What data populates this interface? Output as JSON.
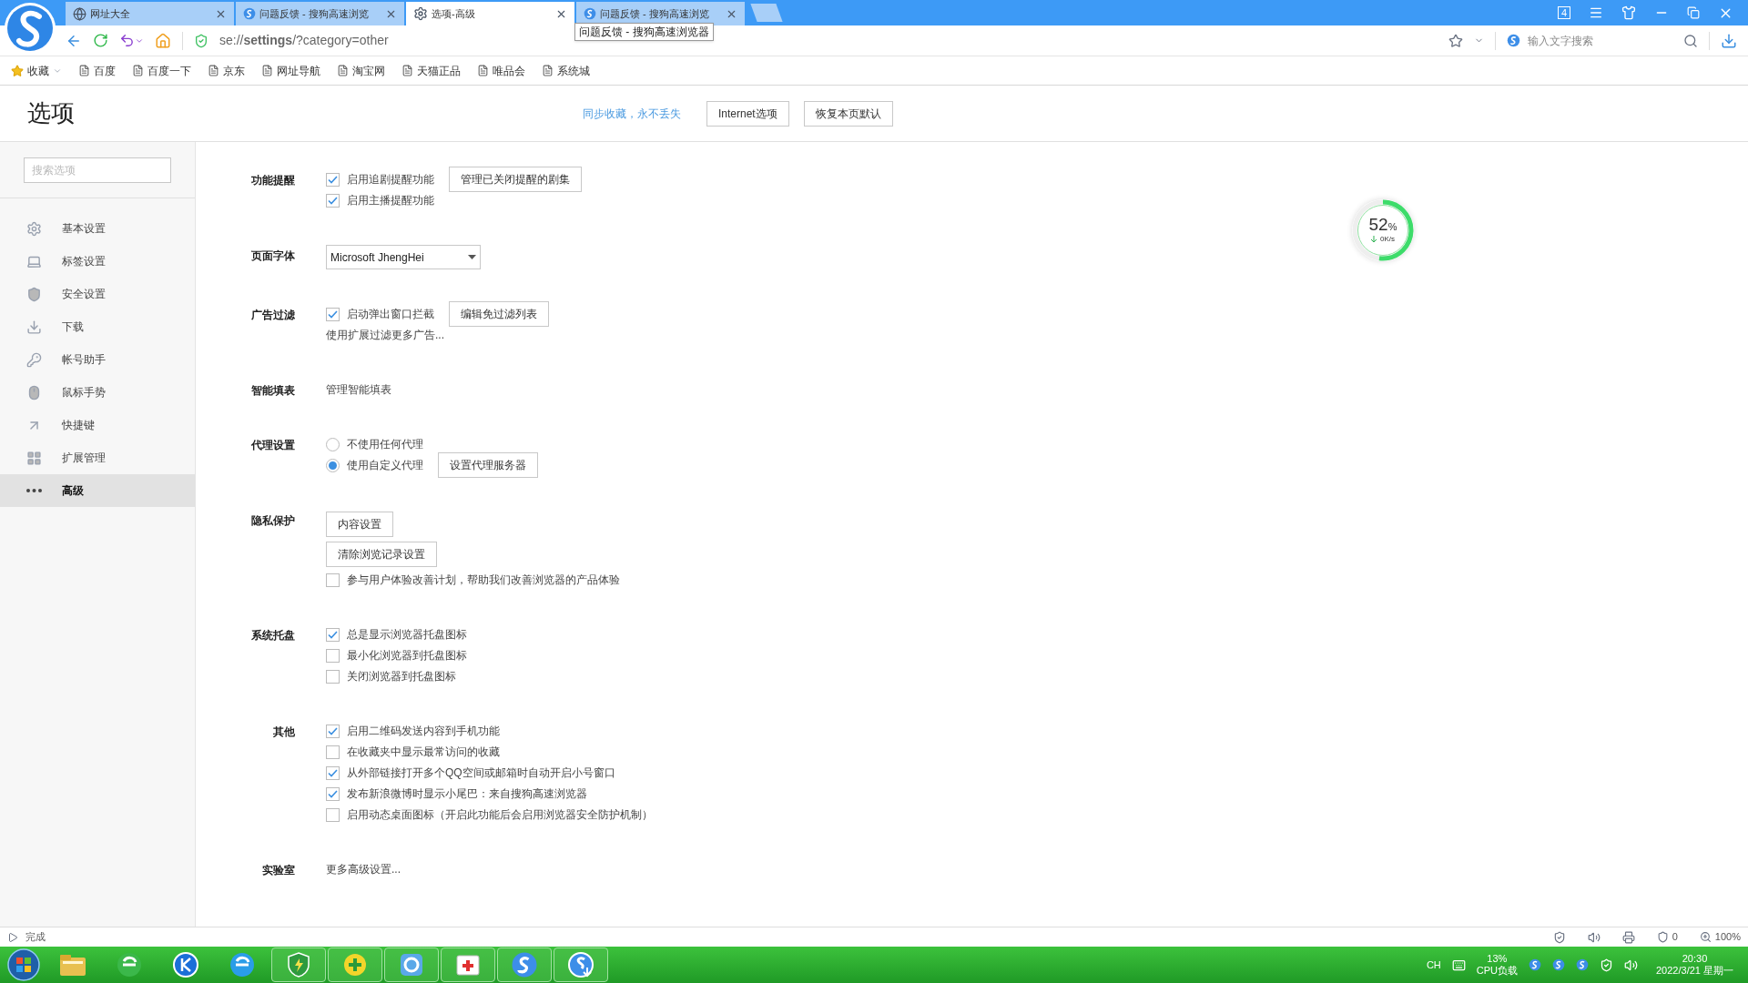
{
  "tabs": [
    {
      "title": "网址大全",
      "selected": false
    },
    {
      "title": "问题反馈 - 搜狗高速浏览",
      "selected": false
    },
    {
      "title": "选项-高级",
      "selected": true
    },
    {
      "title": "问题反馈 - 搜狗高速浏览",
      "selected": false
    }
  ],
  "tooltip": "问题反馈 - 搜狗高速浏览器",
  "tab_count": "4",
  "address": "se://**settings**/?category=other",
  "search": {
    "placeholder": "输入文字搜索"
  },
  "bookmarks": [
    {
      "label": "收藏",
      "kind": "menu"
    },
    {
      "label": "百度",
      "kind": "page"
    },
    {
      "label": "百度一下",
      "kind": "page"
    },
    {
      "label": "京东",
      "kind": "page"
    },
    {
      "label": "网址导航",
      "kind": "page"
    },
    {
      "label": "淘宝网",
      "kind": "page"
    },
    {
      "label": "天猫正品",
      "kind": "page"
    },
    {
      "label": "唯品会",
      "kind": "page"
    },
    {
      "label": "系统城",
      "kind": "page"
    }
  ],
  "header": {
    "title": "选项",
    "sync_link": "同步收藏，永不丢失",
    "buttons": [
      "Internet选项",
      "恢复本页默认"
    ]
  },
  "sidebar": {
    "search": {
      "placeholder": "搜索选项"
    },
    "items": [
      {
        "label": "基本设置",
        "selected": false
      },
      {
        "label": "标签设置",
        "selected": false
      },
      {
        "label": "安全设置",
        "selected": false
      },
      {
        "label": "下载",
        "selected": false
      },
      {
        "label": "帐号助手",
        "selected": false
      },
      {
        "label": "鼠标手势",
        "selected": false
      },
      {
        "label": "快捷键",
        "selected": false
      },
      {
        "label": "扩展管理",
        "selected": false
      },
      {
        "label": "高级",
        "selected": true
      }
    ]
  },
  "sections": [
    {
      "label": "功能提醒",
      "rows": [
        {
          "kind": "checkbox",
          "label": "启用追剧提醒功能",
          "checked": true,
          "button": "管理已关闭提醒的剧集"
        },
        {
          "kind": "checkbox",
          "label": "启用主播提醒功能",
          "checked": true
        }
      ]
    },
    {
      "label": "页面字体",
      "rows": [
        {
          "kind": "select",
          "value": "Microsoft JhengHei"
        }
      ]
    },
    {
      "label": "广告过滤",
      "rows": [
        {
          "kind": "checkbox",
          "label": "启动弹出窗口拦截",
          "checked": true,
          "button": "编辑免过滤列表"
        },
        {
          "kind": "link",
          "label": "使用扩展过滤更多广告..."
        }
      ]
    },
    {
      "label": "智能填表",
      "rows": [
        {
          "kind": "link",
          "label": "管理智能填表"
        }
      ]
    },
    {
      "label": "代理设置",
      "rows": [
        {
          "kind": "radio",
          "label": "不使用任何代理",
          "selected": false
        },
        {
          "kind": "radio",
          "label": "使用自定义代理",
          "selected": true,
          "button": "设置代理服务器"
        }
      ]
    },
    {
      "label": "隐私保护",
      "rows": [
        {
          "kind": "button",
          "label": "内容设置"
        },
        {
          "kind": "button",
          "label": "清除浏览记录设置"
        },
        {
          "kind": "checkbox",
          "label": "参与用户体验改善计划，帮助我们改善浏览器的产品体验",
          "checked": false
        }
      ]
    },
    {
      "label": "系统托盘",
      "rows": [
        {
          "kind": "checkbox",
          "label": "总是显示浏览器托盘图标",
          "checked": true
        },
        {
          "kind": "checkbox",
          "label": "最小化浏览器到托盘图标",
          "checked": false
        },
        {
          "kind": "checkbox",
          "label": "关闭浏览器到托盘图标",
          "checked": false
        }
      ]
    },
    {
      "label": "其他",
      "rows": [
        {
          "kind": "checkbox",
          "label": "启用二维码发送内容到手机功能",
          "checked": true
        },
        {
          "kind": "checkbox",
          "label": "在收藏夹中显示最常访问的收藏",
          "checked": false
        },
        {
          "kind": "checkbox",
          "label": "从外部链接打开多个QQ空间或邮箱时自动开启小号窗口",
          "checked": true
        },
        {
          "kind": "checkbox",
          "label": "发布新浪微博时显示小尾巴：来自搜狗高速浏览器",
          "checked": true
        },
        {
          "kind": "checkbox",
          "label": "启用动态桌面图标（开启此功能后会启用浏览器安全防护机制）",
          "checked": false
        }
      ]
    },
    {
      "label": "实验室",
      "rows": [
        {
          "kind": "link",
          "label": "更多高级设置..."
        }
      ]
    }
  ],
  "meter": {
    "level": 0.52,
    "value": "52",
    "unit": "%",
    "speed": "0K/s"
  },
  "status": {
    "text": "完成",
    "blocked": "0",
    "zoom": "100%"
  },
  "tray": {
    "lang": "CH",
    "cpu": "13%",
    "cpu_label": "CPU负载",
    "time": "20:30",
    "date": "2022/3/21 星期一"
  }
}
